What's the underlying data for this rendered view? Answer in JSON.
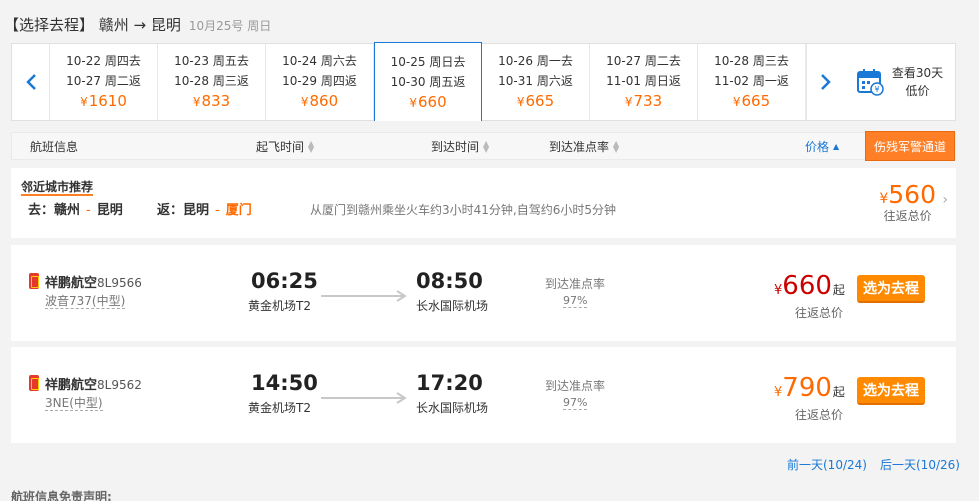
{
  "header": {
    "title": "【选择去程】 赣州 → 昆明",
    "date": "10月25号 周日"
  },
  "date_bar": {
    "items": [
      {
        "go": "10-22 周四去",
        "back": "10-27 周二返",
        "price": "1610"
      },
      {
        "go": "10-23 周五去",
        "back": "10-28 周三返",
        "price": "833"
      },
      {
        "go": "10-24 周六去",
        "back": "10-29 周四返",
        "price": "860"
      },
      {
        "go": "10-25 周日去",
        "back": "10-30 周五返",
        "price": "660"
      },
      {
        "go": "10-26 周一去",
        "back": "10-31 周六返",
        "price": "665"
      },
      {
        "go": "10-27 周二去",
        "back": "11-01 周日返",
        "price": "733"
      },
      {
        "go": "10-28 周三去",
        "back": "11-02 周一返",
        "price": "665"
      }
    ],
    "yen": "¥",
    "cal30_line1": "查看30天",
    "cal30_line2": "低价",
    "prev_icon": "chevron-left-icon",
    "next_icon": "chevron-right-icon"
  },
  "sort_bar": {
    "flight_info": "航班信息",
    "depart_time": "起飞时间",
    "arrive_time": "到达时间",
    "ontime_rate": "到达准点率",
    "price": "价格",
    "warn_button": "伤残军警通道"
  },
  "recommend": {
    "title": "邻近城市推荐",
    "go_label": "去：",
    "go_from": "赣州",
    "go_to": "昆明",
    "back_label": "返：",
    "back_from": "昆明",
    "back_to": "厦门",
    "note": "从厦门到赣州乘坐火车约3小时41分钟,自驾约6小时5分钟",
    "yen": "¥",
    "price": "560",
    "price_sub": "往返总价"
  },
  "flights": [
    {
      "airline": "祥鹏航空",
      "code": "8L9566",
      "plane": "波音737(中型)",
      "dep_time": "06:25",
      "dep_airport": "黄金机场T2",
      "arr_time": "08:50",
      "arr_airport": "长水国际机场",
      "ontime_label": "到达准点率",
      "ontime": "97%",
      "yen": "¥",
      "price": "660",
      "qi": "起",
      "price_sub": "往返总价",
      "select": "选为去程"
    },
    {
      "airline": "祥鹏航空",
      "code": "8L9562",
      "plane": "3NE(中型)",
      "dep_time": "14:50",
      "dep_airport": "黄金机场T2",
      "arr_time": "17:20",
      "arr_airport": "长水国际机场",
      "ontime_label": "到达准点率",
      "ontime": "97%",
      "yen": "¥",
      "price": "790",
      "qi": "起",
      "price_sub": "往返总价",
      "select": "选为去程"
    }
  ],
  "pager": {
    "prev": "前一天(10/24)",
    "next": "后一天(10/26)"
  },
  "disclaimer": "航班信息免责声明:",
  "colors": {
    "accent": "#1a78d6",
    "orange": "#ff6a00",
    "red_price": "#cc0000",
    "select_button": "#ff8a00"
  }
}
